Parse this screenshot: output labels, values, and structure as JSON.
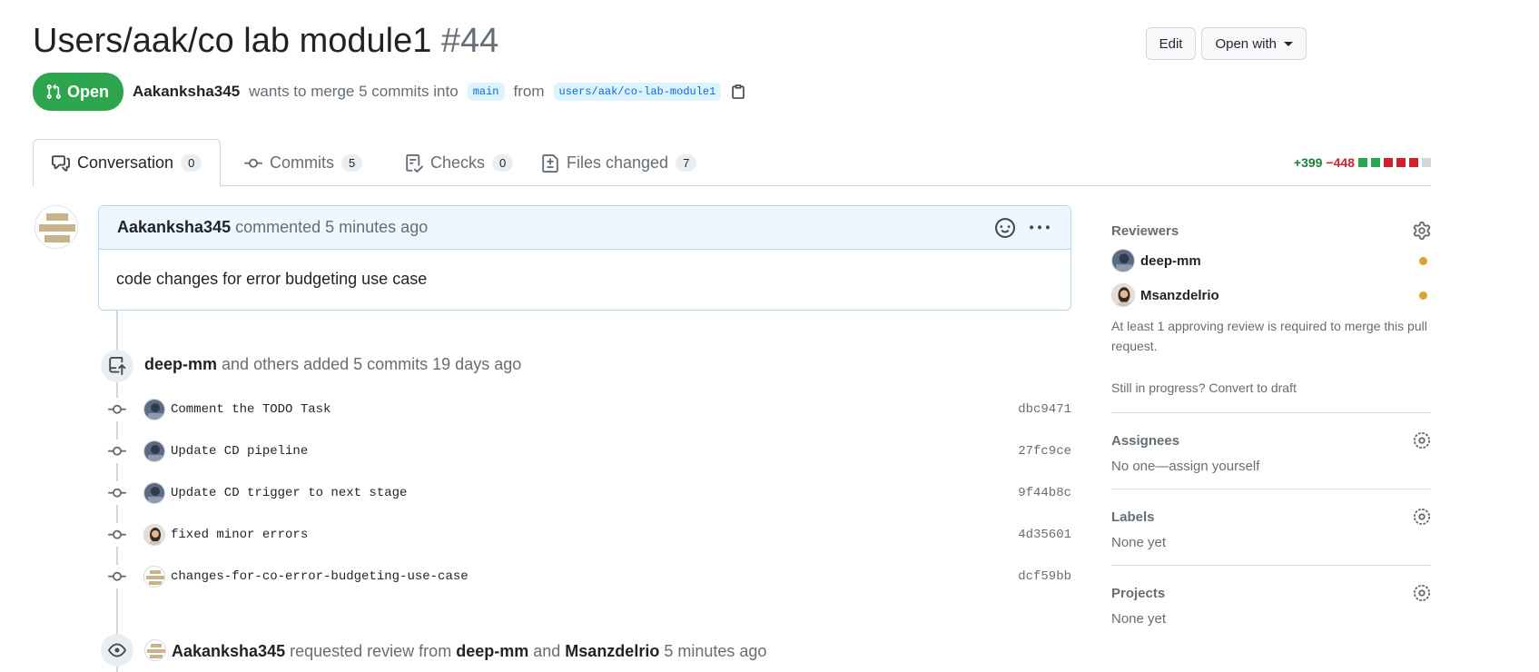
{
  "header": {
    "title": "Users/aak/co lab module1",
    "number": "#44",
    "edit_label": "Edit",
    "open_with_label": "Open with",
    "state": "Open",
    "author": "Aakanksha345",
    "merge_text": "wants to merge 5 commits into",
    "base_branch": "main",
    "from_text": "from",
    "head_branch": "users/aak/co-lab-module1"
  },
  "tabs": [
    {
      "label": "Conversation",
      "count": "0",
      "icon": "comment-discussion-icon",
      "active": true
    },
    {
      "label": "Commits",
      "count": "5",
      "icon": "git-commit-icon"
    },
    {
      "label": "Checks",
      "count": "0",
      "icon": "checklist-icon"
    },
    {
      "label": "Files changed",
      "count": "7",
      "icon": "file-diff-icon"
    }
  ],
  "diffstat": {
    "additions": "+399",
    "deletions": "−448",
    "colors": [
      "#2da44e",
      "#2da44e",
      "#cf222e",
      "#cf222e",
      "#cf222e",
      "#d0d7de"
    ]
  },
  "comment": {
    "author": "Aakanksha345",
    "action": "commented 5 minutes ago",
    "body": "code changes for error budgeting use case"
  },
  "commits_event": {
    "actor": "deep-mm",
    "text": "and others added 5 commits 19 days ago"
  },
  "commits": [
    {
      "message": "Comment the TODO Task",
      "sha": "dbc9471",
      "avatar": "deep-mm"
    },
    {
      "message": "Update CD pipeline",
      "sha": "27fc9ce",
      "avatar": "deep-mm"
    },
    {
      "message": "Update CD trigger to next stage",
      "sha": "9f44b8c",
      "avatar": "deep-mm"
    },
    {
      "message": "fixed minor errors",
      "sha": "4d35601",
      "avatar": "Msanzdelrio"
    },
    {
      "message": "changes-for-co-error-budgeting-use-case",
      "sha": "dcf59bb",
      "avatar": "Aakanksha345"
    }
  ],
  "review_event": {
    "actor": "Aakanksha345",
    "text1": "requested review from",
    "reviewer1": "deep-mm",
    "and": "and",
    "reviewer2": "Msanzdelrio",
    "time": "5 minutes ago"
  },
  "sidebar": {
    "reviewers": {
      "title": "Reviewers",
      "items": [
        {
          "name": "deep-mm"
        },
        {
          "name": "Msanzdelrio"
        }
      ],
      "note": "At least 1 approving review is required to merge this pull request.",
      "draft_text": "Still in progress? Convert to draft"
    },
    "assignees": {
      "title": "Assignees",
      "value": "No one—assign yourself"
    },
    "labels": {
      "title": "Labels",
      "value": "None yet"
    },
    "projects": {
      "title": "Projects",
      "value": "None yet"
    }
  }
}
